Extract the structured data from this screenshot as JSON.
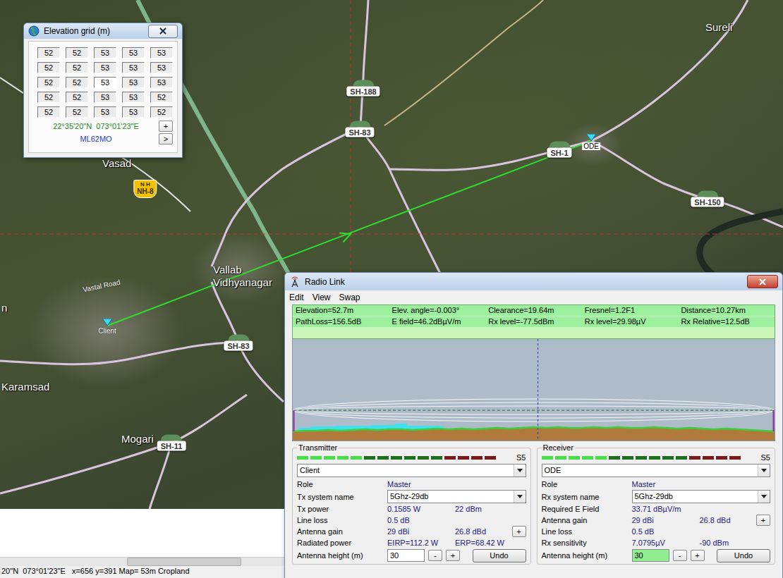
{
  "map": {
    "places": [
      {
        "name": "Sureli"
      },
      {
        "name": "Vasad"
      },
      {
        "name": "Vallab"
      },
      {
        "name": "Vidhyanagar"
      },
      {
        "name": "Karamsad"
      },
      {
        "name": "Mogari"
      },
      {
        "name": "n"
      }
    ],
    "road_label": "Vastal Road",
    "shields": [
      {
        "label": "SH-188"
      },
      {
        "label": "SH-83"
      },
      {
        "label": "SH-83"
      },
      {
        "label": "SH-150"
      },
      {
        "label": "SH-11"
      },
      {
        "label": "SH-1"
      }
    ],
    "national_shield": {
      "top": "N H",
      "label": "NH-8"
    },
    "sites": [
      {
        "name": "Client",
        "kind": "plain"
      },
      {
        "name": "ODE",
        "kind": "boxed"
      }
    ]
  },
  "status_bar": "20\"N  073°01'23\"E   x=656 y=391 Map= 53m Cropland",
  "elevation_window": {
    "title": "Elevation grid (m)",
    "cells": [
      [
        {
          "value": "52",
          "selected": false
        },
        {
          "value": "52",
          "selected": false
        },
        {
          "value": "53",
          "selected": false
        },
        {
          "value": "53",
          "selected": false
        },
        {
          "value": "53",
          "selected": false
        }
      ],
      [
        {
          "value": "52",
          "selected": false
        },
        {
          "value": "52",
          "selected": false
        },
        {
          "value": "53",
          "selected": false
        },
        {
          "value": "53",
          "selected": false
        },
        {
          "value": "53",
          "selected": false
        }
      ],
      [
        {
          "value": "52",
          "selected": false
        },
        {
          "value": "52",
          "selected": false
        },
        {
          "value": "53",
          "selected": true
        },
        {
          "value": "53",
          "selected": false
        },
        {
          "value": "53",
          "selected": false
        }
      ],
      [
        {
          "value": "52",
          "selected": false
        },
        {
          "value": "52",
          "selected": false
        },
        {
          "value": "53",
          "selected": false
        },
        {
          "value": "53",
          "selected": false
        },
        {
          "value": "52",
          "selected": false
        }
      ],
      [
        {
          "value": "52",
          "selected": false
        },
        {
          "value": "52",
          "selected": false
        },
        {
          "value": "53",
          "selected": false
        },
        {
          "value": "53",
          "selected": false
        },
        {
          "value": "52",
          "selected": false
        }
      ]
    ],
    "coords": "22°35'20\"N  073°01'23\"E",
    "coords_button": "+",
    "locator": "ML62MO",
    "locator_button": ">"
  },
  "radio_link": {
    "title": "Radio Link",
    "menu": [
      "Edit",
      "View",
      "Swap"
    ],
    "info_rows": [
      [
        "Elevation=52.7m",
        "Elev. angle=-0.003°",
        "Clearance=19.64m",
        "Fresnel=1.2F1",
        "Distance=10.27km"
      ],
      [
        "PathLoss=156.5dB",
        "E field=46.2dBµV/m",
        "Rx level=-77.5dBm",
        "Rx level=29.98µV",
        "Rx Relative=12.5dB"
      ],
      []
    ],
    "profile": {
      "terrain_m": [
        47,
        48,
        48,
        49,
        48,
        49,
        50,
        49,
        50,
        50,
        49,
        50,
        51,
        50,
        51,
        50,
        51,
        52,
        51,
        52,
        53,
        52,
        53,
        52,
        52,
        53,
        52,
        53,
        52,
        52,
        53,
        52,
        51,
        52,
        51,
        50,
        51,
        50,
        49,
        48,
        47
      ],
      "clutter_m": [
        0,
        4,
        6,
        5,
        7,
        6,
        5,
        7,
        6,
        8,
        6,
        5,
        4,
        0,
        0,
        0,
        0,
        0,
        0,
        0,
        0,
        0,
        0,
        0,
        0,
        0,
        0,
        0,
        0,
        0,
        0,
        0,
        0,
        0,
        0,
        0,
        0,
        0,
        0,
        0,
        0
      ]
    },
    "transmitter": {
      "legend": "Transmitter",
      "meter": {
        "level": 0.33,
        "reading": "S5"
      },
      "site": "Client",
      "rows": [
        {
          "kind": "text",
          "label": "Role",
          "value": "Master"
        },
        {
          "kind": "select",
          "label": "Tx system name",
          "value": "5Ghz-29db"
        },
        {
          "kind": "pair",
          "label": "Tx power",
          "value": "0.1585 W",
          "value2": "22 dBm"
        },
        {
          "kind": "text",
          "label": "Line loss",
          "value": "0.5 dB"
        },
        {
          "kind": "pair",
          "label": "Antenna gain",
          "value": "29 dBi",
          "value2": "26.8 dBd",
          "button": "+"
        },
        {
          "kind": "pair",
          "label": "Radiated power",
          "value": "EIRP=112.2 W",
          "value2": "ERP=68.42 W"
        },
        {
          "kind": "height",
          "label": "Antenna height (m)",
          "value": "30",
          "highlighted": false,
          "buttons": [
            "-",
            "+"
          ],
          "undo": "Undo"
        }
      ]
    },
    "receiver": {
      "legend": "Receiver",
      "meter": {
        "level": 0.33,
        "reading": "S5"
      },
      "site": "ODE",
      "rows": [
        {
          "kind": "text",
          "label": "Role",
          "value": "Master"
        },
        {
          "kind": "select",
          "label": "Rx system name",
          "value": "5Ghz-29db"
        },
        {
          "kind": "text",
          "label": "Required E Field",
          "value": "33.71 dBµV/m"
        },
        {
          "kind": "pair",
          "label": "Antenna gain",
          "value": "29 dBi",
          "value2": "26.8 dBd",
          "button": "+"
        },
        {
          "kind": "text",
          "label": "Line loss",
          "value": "0.5 dB"
        },
        {
          "kind": "pair",
          "label": "Rx sensitivity",
          "value": "7.0795µV",
          "value2": "-90 dBm"
        },
        {
          "kind": "height",
          "label": "Antenna height (m)",
          "value": "30",
          "highlighted": true,
          "buttons": [
            "-",
            "+"
          ],
          "undo": "Undo"
        }
      ]
    }
  }
}
